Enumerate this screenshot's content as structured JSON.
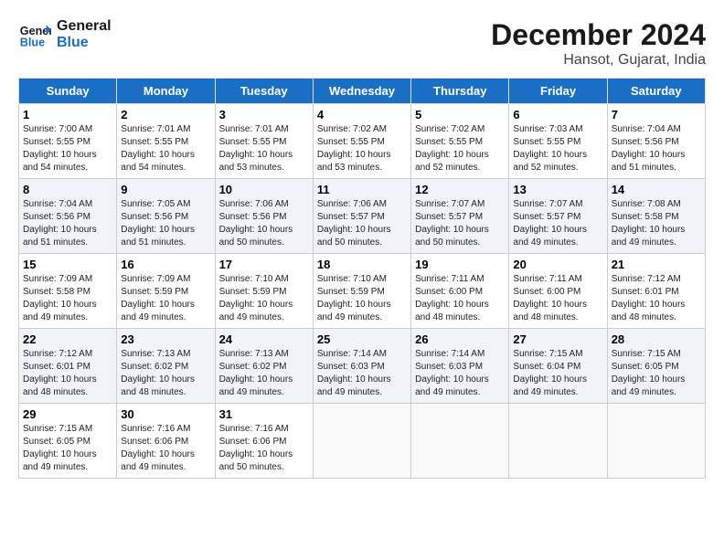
{
  "header": {
    "logo_line1": "General",
    "logo_line2": "Blue",
    "month_title": "December 2024",
    "location": "Hansot, Gujarat, India"
  },
  "weekdays": [
    "Sunday",
    "Monday",
    "Tuesday",
    "Wednesday",
    "Thursday",
    "Friday",
    "Saturday"
  ],
  "weeks": [
    [
      {
        "day": "1",
        "sunrise": "7:00 AM",
        "sunset": "5:55 PM",
        "daylight": "10 hours and 54 minutes."
      },
      {
        "day": "2",
        "sunrise": "7:01 AM",
        "sunset": "5:55 PM",
        "daylight": "10 hours and 54 minutes."
      },
      {
        "day": "3",
        "sunrise": "7:01 AM",
        "sunset": "5:55 PM",
        "daylight": "10 hours and 53 minutes."
      },
      {
        "day": "4",
        "sunrise": "7:02 AM",
        "sunset": "5:55 PM",
        "daylight": "10 hours and 53 minutes."
      },
      {
        "day": "5",
        "sunrise": "7:02 AM",
        "sunset": "5:55 PM",
        "daylight": "10 hours and 52 minutes."
      },
      {
        "day": "6",
        "sunrise": "7:03 AM",
        "sunset": "5:55 PM",
        "daylight": "10 hours and 52 minutes."
      },
      {
        "day": "7",
        "sunrise": "7:04 AM",
        "sunset": "5:56 PM",
        "daylight": "10 hours and 51 minutes."
      }
    ],
    [
      {
        "day": "8",
        "sunrise": "7:04 AM",
        "sunset": "5:56 PM",
        "daylight": "10 hours and 51 minutes."
      },
      {
        "day": "9",
        "sunrise": "7:05 AM",
        "sunset": "5:56 PM",
        "daylight": "10 hours and 51 minutes."
      },
      {
        "day": "10",
        "sunrise": "7:06 AM",
        "sunset": "5:56 PM",
        "daylight": "10 hours and 50 minutes."
      },
      {
        "day": "11",
        "sunrise": "7:06 AM",
        "sunset": "5:57 PM",
        "daylight": "10 hours and 50 minutes."
      },
      {
        "day": "12",
        "sunrise": "7:07 AM",
        "sunset": "5:57 PM",
        "daylight": "10 hours and 50 minutes."
      },
      {
        "day": "13",
        "sunrise": "7:07 AM",
        "sunset": "5:57 PM",
        "daylight": "10 hours and 49 minutes."
      },
      {
        "day": "14",
        "sunrise": "7:08 AM",
        "sunset": "5:58 PM",
        "daylight": "10 hours and 49 minutes."
      }
    ],
    [
      {
        "day": "15",
        "sunrise": "7:09 AM",
        "sunset": "5:58 PM",
        "daylight": "10 hours and 49 minutes."
      },
      {
        "day": "16",
        "sunrise": "7:09 AM",
        "sunset": "5:59 PM",
        "daylight": "10 hours and 49 minutes."
      },
      {
        "day": "17",
        "sunrise": "7:10 AM",
        "sunset": "5:59 PM",
        "daylight": "10 hours and 49 minutes."
      },
      {
        "day": "18",
        "sunrise": "7:10 AM",
        "sunset": "5:59 PM",
        "daylight": "10 hours and 49 minutes."
      },
      {
        "day": "19",
        "sunrise": "7:11 AM",
        "sunset": "6:00 PM",
        "daylight": "10 hours and 48 minutes."
      },
      {
        "day": "20",
        "sunrise": "7:11 AM",
        "sunset": "6:00 PM",
        "daylight": "10 hours and 48 minutes."
      },
      {
        "day": "21",
        "sunrise": "7:12 AM",
        "sunset": "6:01 PM",
        "daylight": "10 hours and 48 minutes."
      }
    ],
    [
      {
        "day": "22",
        "sunrise": "7:12 AM",
        "sunset": "6:01 PM",
        "daylight": "10 hours and 48 minutes."
      },
      {
        "day": "23",
        "sunrise": "7:13 AM",
        "sunset": "6:02 PM",
        "daylight": "10 hours and 48 minutes."
      },
      {
        "day": "24",
        "sunrise": "7:13 AM",
        "sunset": "6:02 PM",
        "daylight": "10 hours and 49 minutes."
      },
      {
        "day": "25",
        "sunrise": "7:14 AM",
        "sunset": "6:03 PM",
        "daylight": "10 hours and 49 minutes."
      },
      {
        "day": "26",
        "sunrise": "7:14 AM",
        "sunset": "6:03 PM",
        "daylight": "10 hours and 49 minutes."
      },
      {
        "day": "27",
        "sunrise": "7:15 AM",
        "sunset": "6:04 PM",
        "daylight": "10 hours and 49 minutes."
      },
      {
        "day": "28",
        "sunrise": "7:15 AM",
        "sunset": "6:05 PM",
        "daylight": "10 hours and 49 minutes."
      }
    ],
    [
      {
        "day": "29",
        "sunrise": "7:15 AM",
        "sunset": "6:05 PM",
        "daylight": "10 hours and 49 minutes."
      },
      {
        "day": "30",
        "sunrise": "7:16 AM",
        "sunset": "6:06 PM",
        "daylight": "10 hours and 49 minutes."
      },
      {
        "day": "31",
        "sunrise": "7:16 AM",
        "sunset": "6:06 PM",
        "daylight": "10 hours and 50 minutes."
      },
      null,
      null,
      null,
      null
    ]
  ]
}
